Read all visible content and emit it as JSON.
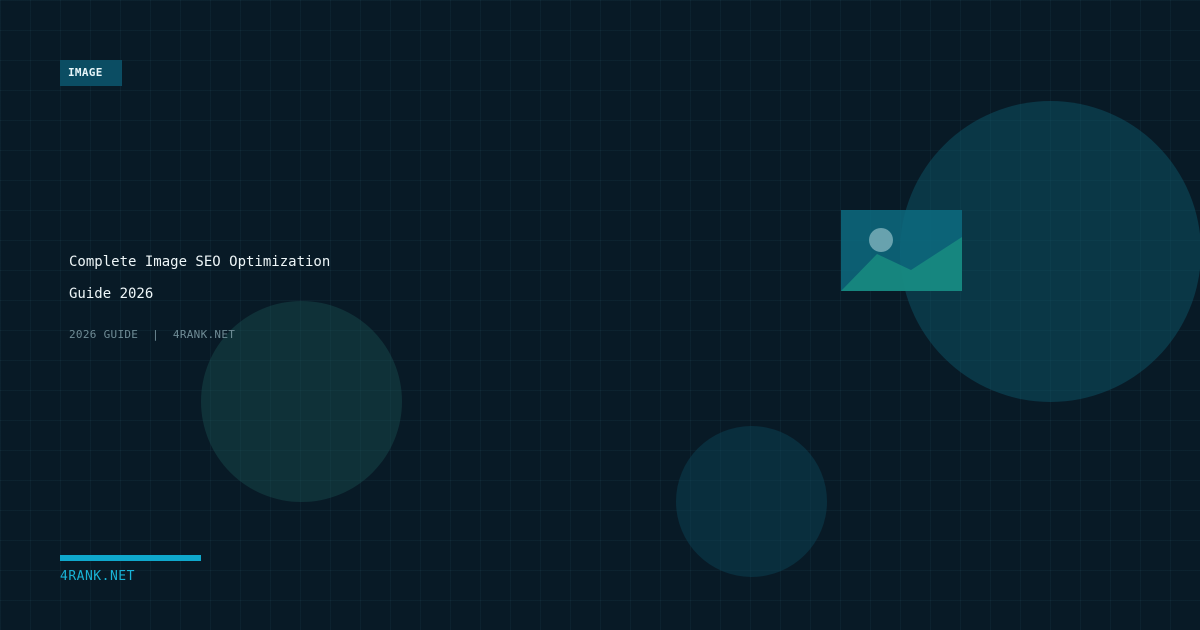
{
  "tag": {
    "label": "IMAGE"
  },
  "title": {
    "line1": "Complete Image SEO Optimization",
    "line2": "Guide 2026"
  },
  "meta": {
    "guide": "2026 GUIDE",
    "separator": "|",
    "site": "4RANK.NET"
  },
  "brand": {
    "label": "4RANK.NET"
  },
  "icon": "image-icon",
  "colors": {
    "background": "#081a26",
    "tag_background": "#0b4d63",
    "accent": "#0fa8cc",
    "brand_text": "#19b3d6"
  }
}
